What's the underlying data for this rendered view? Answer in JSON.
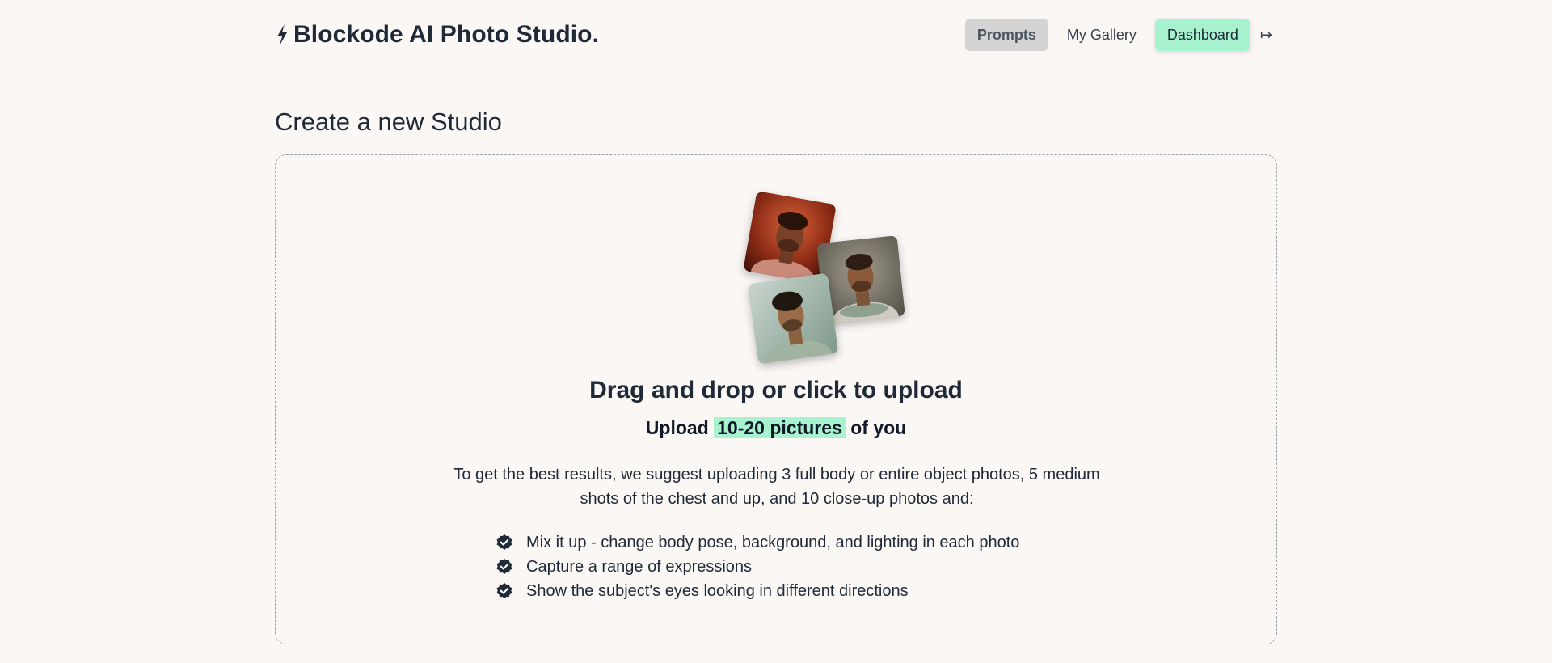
{
  "header": {
    "brand": "Blockode AI Photo Studio.",
    "brand_icon": "lightning-bolt-icon",
    "nav": {
      "prompts": "Prompts",
      "gallery": "My Gallery",
      "dashboard": "Dashboard",
      "logout_glyph": "↦"
    }
  },
  "page": {
    "title": "Create a new Studio"
  },
  "upload": {
    "title": "Drag and drop or click to upload",
    "sub_before": "Upload",
    "sub_highlight": "10-20 pictures",
    "sub_after": "of you",
    "suggestion": "To get the best results, we suggest uploading 3 full body or entire object photos, 5 medium shots of the chest and up, and 10 close-up photos and:",
    "tips": [
      "Mix it up - change body pose, background, and lighting in each photo",
      "Capture a range of expressions",
      "Show the subject's eyes looking in different directions"
    ]
  },
  "colors": {
    "accent": "#a7f3d0",
    "background": "#faf7f5",
    "text": "#1f2937"
  }
}
